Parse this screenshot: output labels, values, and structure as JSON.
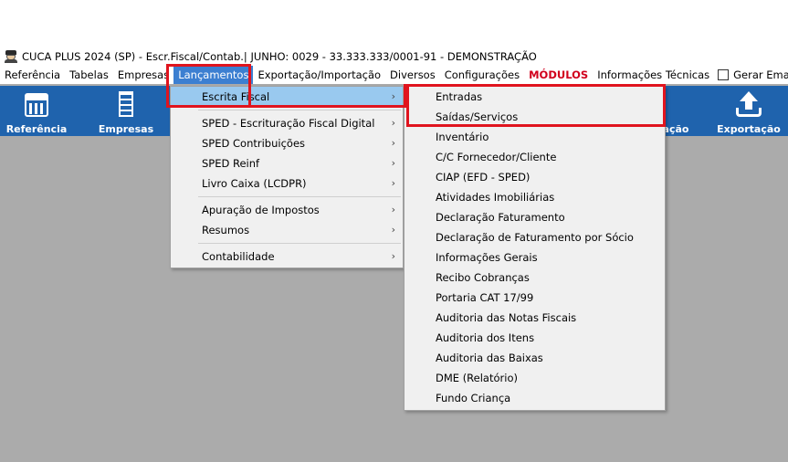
{
  "window": {
    "title": "CUCA PLUS 2024 (SP) - Escr.Fiscal/Contab.| JUNHO: 0029 - 33.333.333/0001-91 - DEMONSTRAÇÃO",
    "icon": "accountant-person-icon"
  },
  "menubar": {
    "items": [
      "Referência",
      "Tabelas",
      "Empresas",
      "Lançamentos",
      "Exportação/Importação",
      "Diversos",
      "Configurações",
      "MÓDULOS",
      "Informações Técnicas"
    ],
    "gerar_email": "Gerar Email",
    "gerar_email_checked": false,
    "trailing_checked": true,
    "trailing_label": "E",
    "modulos_color": "#d1001c",
    "active_color": "#3c7fd1"
  },
  "toolbar": {
    "background": "#1f63ad",
    "referencia": "Referência",
    "empresas": "Empresas",
    "partial": "ação",
    "exportacao": "Exportação"
  },
  "lancamentos_menu": {
    "items": [
      "Escrita Fiscal",
      "SPED - Escrituração Fiscal Digital",
      "SPED Contribuições",
      "SPED Reinf",
      "Livro Caixa (LCDPR)",
      "Apuração de Impostos",
      "Resumos",
      "Contabilidade"
    ]
  },
  "escrita_fiscal_menu": {
    "items": [
      "Entradas",
      "Saídas/Serviços",
      "Inventário",
      "C/C Fornecedor/Cliente",
      "CIAP (EFD - SPED)",
      "Atividades Imobiliárias",
      "Declaração Faturamento",
      "Declaração de Faturamento por Sócio",
      "Informações Gerais",
      "Recibo Cobranças",
      "Portaria CAT 17/99",
      "Auditoria das Notas Fiscais",
      "Auditoria dos Itens",
      "Auditoria das Baixas",
      "DME (Relatório)",
      "Fundo Criança"
    ]
  },
  "highlight_color": "#e0141e",
  "submenu_arrow": "›"
}
